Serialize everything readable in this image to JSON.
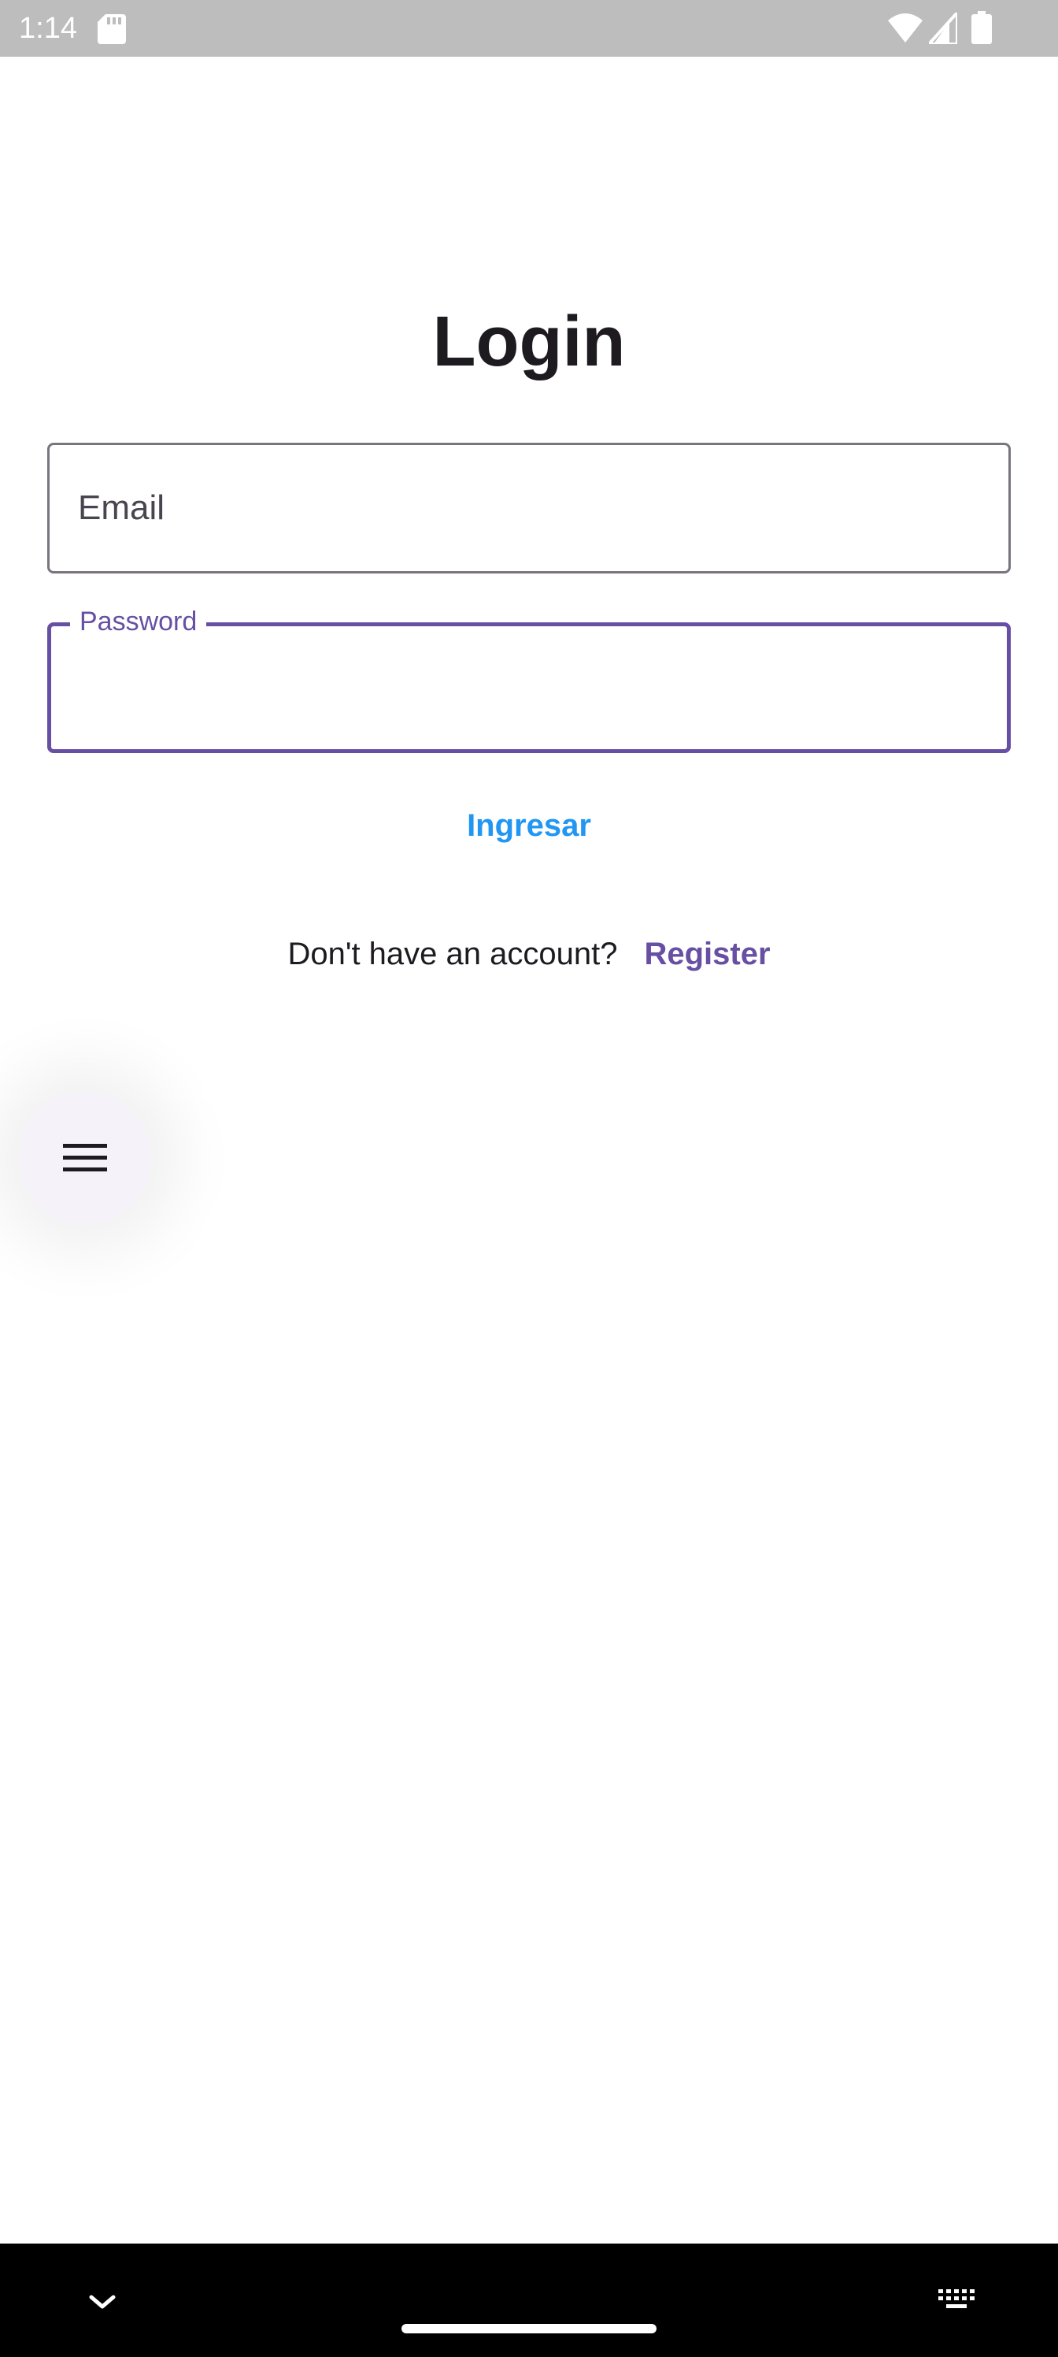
{
  "status_bar": {
    "time": "1:14",
    "icons": [
      "sd-card-icon",
      "wifi-icon",
      "signal-icon",
      "battery-icon"
    ]
  },
  "login": {
    "title": "Login",
    "email_label": "Email",
    "password_label": "Password",
    "submit_label": "Ingresar",
    "register_prompt": "Don't have an account?",
    "register_link": "Register"
  },
  "fab": {
    "icon": "menu-icon"
  },
  "nav_bar": {
    "icons": [
      "chevron-down-icon",
      "home-pill",
      "keyboard-icon"
    ]
  },
  "colors": {
    "accent": "#6750a4",
    "submit": "#2196f3",
    "text": "#1d1b20",
    "outline": "#79747e",
    "status_bar": "#bdbdbd",
    "nav_bar": "#000000"
  }
}
